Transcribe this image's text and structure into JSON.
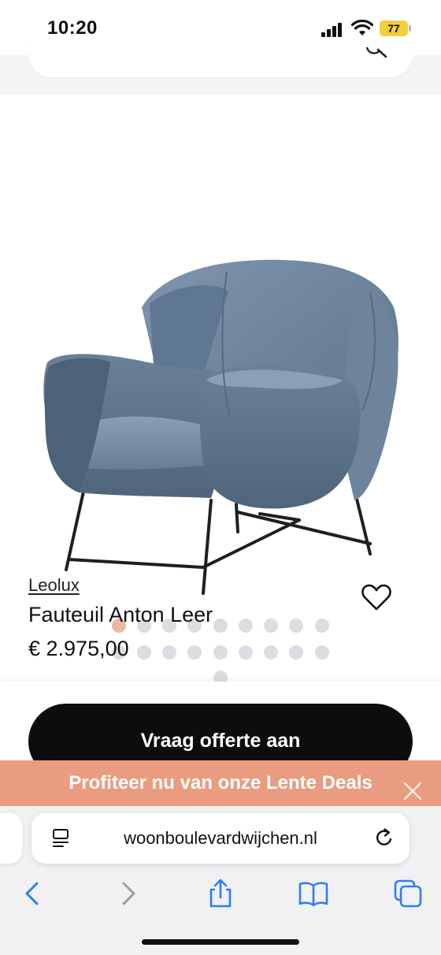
{
  "status_bar": {
    "time": "10:20",
    "battery": "77"
  },
  "product": {
    "brand": "Leolux",
    "name": "Fauteuil Anton Leer",
    "price": "€ 2.975,00",
    "image_icon": "armchair-image",
    "gallery": {
      "total": 19,
      "active_index": 0
    }
  },
  "cta": {
    "label": "Vraag offerte aan"
  },
  "promo": {
    "text": "Profiteer nu van onze Lente Deals"
  },
  "browser": {
    "url": "woonboulevardwijchen.nl",
    "toolbar_icons": [
      "back-icon",
      "forward-icon",
      "share-icon",
      "bookmarks-icon",
      "tabs-icon"
    ]
  },
  "colors": {
    "accent_dot": "#e8b9a4",
    "promo_bg": "#e99c80",
    "cta_bg": "#0d0d0d",
    "safari_blue": "#2f7cf6"
  }
}
